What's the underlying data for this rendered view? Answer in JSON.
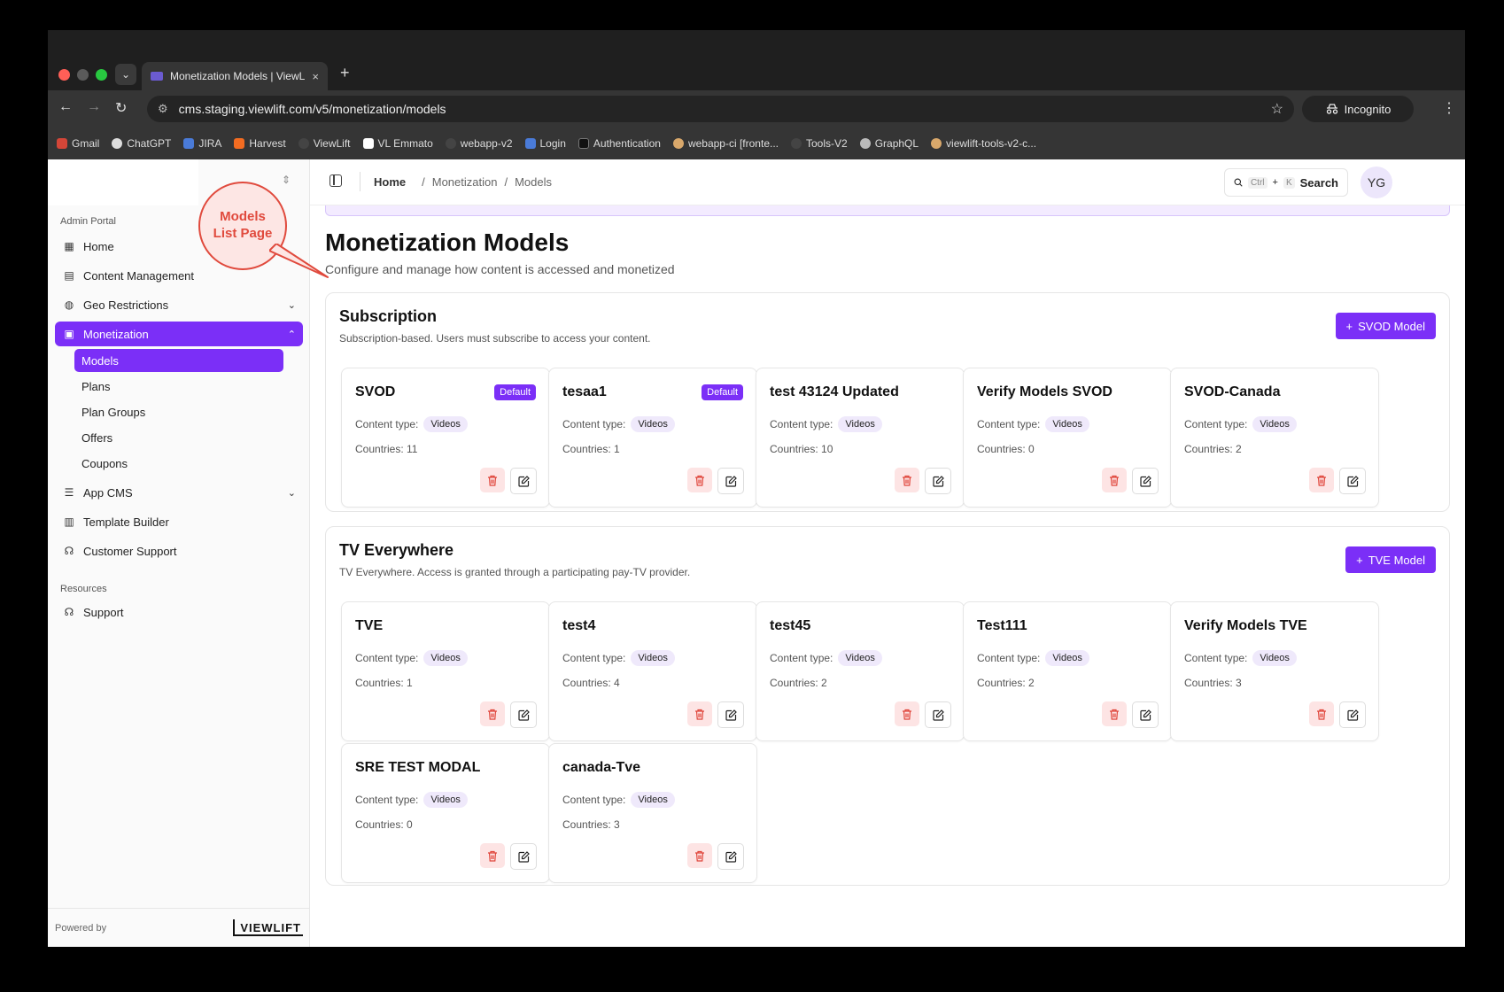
{
  "browser": {
    "tab_title": "Monetization Models | ViewLift",
    "tab_close": "×",
    "new_tab": "+",
    "url": "cms.staging.viewlift.com/v5/monetization/models",
    "incognito_label": "Incognito",
    "bookmarks": [
      "Gmail",
      "ChatGPT",
      "JIRA",
      "Harvest",
      "ViewLift",
      "VL Emmato",
      "webapp-v2",
      "Login",
      "Authentication",
      "webapp-ci [fronte...",
      "Tools-V2",
      "GraphQL",
      "viewlift-tools-v2-c..."
    ]
  },
  "sidebar": {
    "group_admin": "Admin Portal",
    "items": {
      "home": "Home",
      "content": "Content Management",
      "geo": "Geo Restrictions",
      "monetization": "Monetization",
      "appcms": "App CMS",
      "template": "Template Builder",
      "support_customer": "Customer Support"
    },
    "sub_items": {
      "models": "Models",
      "plans": "Plans",
      "plan_groups": "Plan Groups",
      "offers": "Offers",
      "coupons": "Coupons"
    },
    "group_resources": "Resources",
    "support": "Support",
    "powered_by": "Powered by",
    "logo_text": "VIEWLIFT"
  },
  "callout": {
    "line1": "Models",
    "line2": "List Page",
    "color": "#e04a3d"
  },
  "topbar": {
    "crumb_home": "Home",
    "crumb_sep": "/",
    "crumb_monetization": "Monetization",
    "crumb_models": "Models",
    "search_kbd_ctrl": "Ctrl",
    "search_kbd_plus": "+",
    "search_kbd_k": "K",
    "search_label": "Search",
    "avatar_initials": "YG"
  },
  "page": {
    "title": "Monetization Models",
    "subtitle": "Configure and manage how content is accessed and monetized"
  },
  "labels": {
    "content_type": "Content type:",
    "default_badge": "Default"
  },
  "sections": [
    {
      "title": "Subscription",
      "description": "Subscription-based. Users must subscribe to access your content.",
      "button": "SVOD Model",
      "cards": [
        {
          "name": "SVOD",
          "content_type": "Videos",
          "countries": "Countries: 11",
          "default": true
        },
        {
          "name": "tesaa1",
          "content_type": "Videos",
          "countries": "Countries: 1",
          "default": true
        },
        {
          "name": "test 43124 Updated",
          "content_type": "Videos",
          "countries": "Countries: 10",
          "default": false
        },
        {
          "name": "Verify Models SVOD",
          "content_type": "Videos",
          "countries": "Countries: 0",
          "default": false
        },
        {
          "name": "SVOD-Canada",
          "content_type": "Videos",
          "countries": "Countries: 2",
          "default": false
        }
      ]
    },
    {
      "title": "TV Everywhere",
      "description": "TV Everywhere. Access is granted through a participating pay-TV provider.",
      "button": "TVE Model",
      "cards": [
        {
          "name": "TVE",
          "content_type": "Videos",
          "countries": "Countries: 1",
          "default": false
        },
        {
          "name": "test4",
          "content_type": "Videos",
          "countries": "Countries: 4",
          "default": false
        },
        {
          "name": "test45",
          "content_type": "Videos",
          "countries": "Countries: 2",
          "default": false
        },
        {
          "name": "Test111",
          "content_type": "Videos",
          "countries": "Countries: 2",
          "default": false
        },
        {
          "name": "Verify Models TVE",
          "content_type": "Videos",
          "countries": "Countries: 3",
          "default": false
        },
        {
          "name": "SRE TEST MODAL",
          "content_type": "Videos",
          "countries": "Countries: 0",
          "default": false
        },
        {
          "name": "canada-Tve",
          "content_type": "Videos",
          "countries": "Countries: 3",
          "default": false
        }
      ]
    }
  ],
  "colors": {
    "accent": "#7b2ff7",
    "delete": "#e0453a"
  }
}
